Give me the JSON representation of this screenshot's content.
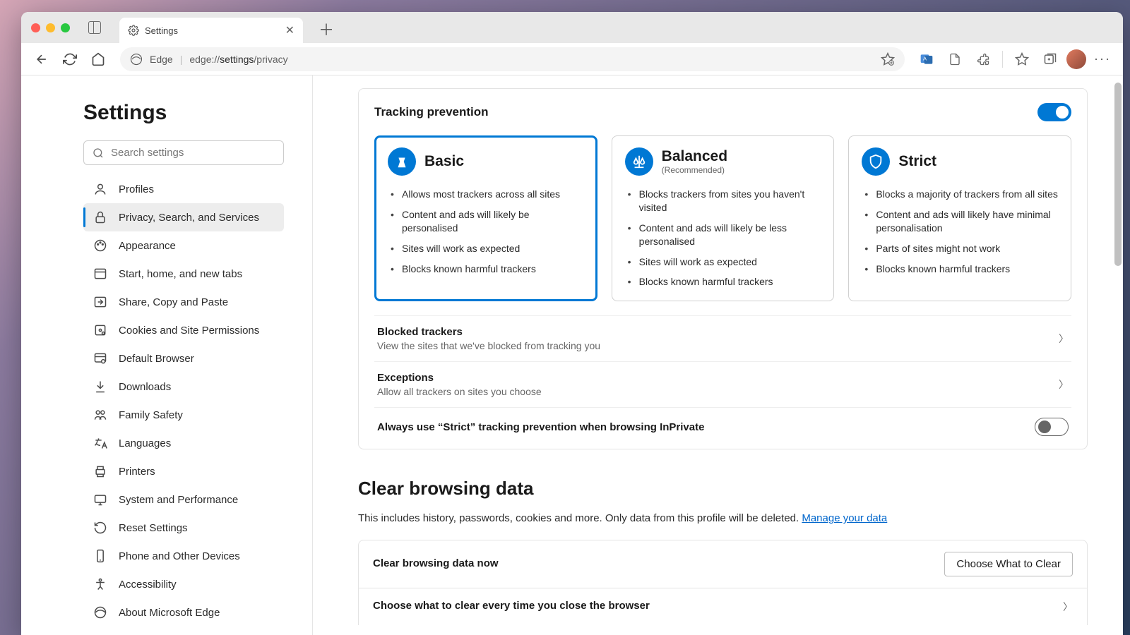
{
  "window": {
    "tab_title": "Settings",
    "traffic": [
      "close",
      "minimize",
      "maximize"
    ]
  },
  "toolbar": {
    "edge_label": "Edge",
    "url_prefix": "edge://",
    "url_bold": "settings",
    "url_suffix": "/privacy"
  },
  "sidebar": {
    "title": "Settings",
    "search_placeholder": "Search settings",
    "items": [
      {
        "icon": "profile",
        "label": "Profiles"
      },
      {
        "icon": "lock",
        "label": "Privacy, Search, and Services"
      },
      {
        "icon": "palette",
        "label": "Appearance"
      },
      {
        "icon": "window",
        "label": "Start, home, and new tabs"
      },
      {
        "icon": "share",
        "label": "Share, Copy and Paste"
      },
      {
        "icon": "cookie",
        "label": "Cookies and Site Permissions"
      },
      {
        "icon": "browser",
        "label": "Default Browser"
      },
      {
        "icon": "download",
        "label": "Downloads"
      },
      {
        "icon": "family",
        "label": "Family Safety"
      },
      {
        "icon": "language",
        "label": "Languages"
      },
      {
        "icon": "printer",
        "label": "Printers"
      },
      {
        "icon": "system",
        "label": "System and Performance"
      },
      {
        "icon": "reset",
        "label": "Reset Settings"
      },
      {
        "icon": "phone",
        "label": "Phone and Other Devices"
      },
      {
        "icon": "accessibility",
        "label": "Accessibility"
      },
      {
        "icon": "edge",
        "label": "About Microsoft Edge"
      }
    ],
    "active_index": 1
  },
  "tracking": {
    "heading": "Tracking prevention",
    "toggle_on": true,
    "cards": [
      {
        "title": "Basic",
        "subtitle": "",
        "selected": true,
        "points": [
          "Allows most trackers across all sites",
          "Content and ads will likely be personalised",
          "Sites will work as expected",
          "Blocks known harmful trackers"
        ]
      },
      {
        "title": "Balanced",
        "subtitle": "(Recommended)",
        "selected": false,
        "points": [
          "Blocks trackers from sites you haven't visited",
          "Content and ads will likely be less personalised",
          "Sites will work as expected",
          "Blocks known harmful trackers"
        ]
      },
      {
        "title": "Strict",
        "subtitle": "",
        "selected": false,
        "points": [
          "Blocks a majority of trackers from all sites",
          "Content and ads will likely have minimal personalisation",
          "Parts of sites might not work",
          "Blocks known harmful trackers"
        ]
      }
    ],
    "rows": [
      {
        "title": "Blocked trackers",
        "sub": "View the sites that we've blocked from tracking you"
      },
      {
        "title": "Exceptions",
        "sub": "Allow all trackers on sites you choose"
      }
    ],
    "strict_inprivate": "Always use “Strict” tracking prevention when browsing InPrivate",
    "strict_toggle_on": false
  },
  "clear": {
    "heading": "Clear browsing data",
    "desc": "This includes history, passwords, cookies and more. Only data from this profile will be deleted. ",
    "link": "Manage your data",
    "row1_title": "Clear browsing data now",
    "row1_button": "Choose What to Clear",
    "row2_title": "Choose what to clear every time you close the browser"
  }
}
